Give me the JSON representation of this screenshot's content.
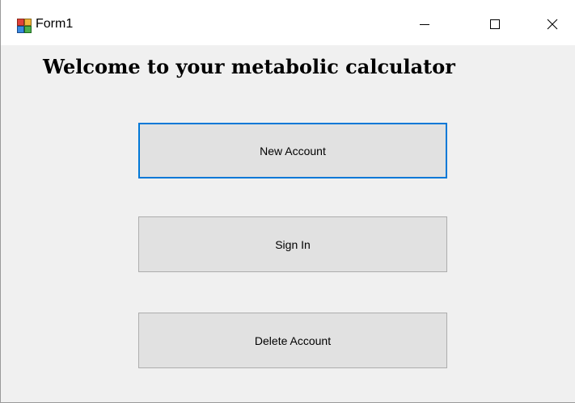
{
  "window": {
    "title": "Form1",
    "icon": "winforms-form-icon",
    "controls": {
      "minimize_icon": "minimize-icon",
      "maximize_icon": "maximize-icon",
      "close_icon": "close-icon"
    }
  },
  "form": {
    "heading": "Welcome to your metabolic calculator",
    "buttons": {
      "new_account": "New Account",
      "sign_in": "Sign In",
      "delete_account": "Delete Account"
    }
  },
  "colors": {
    "form_background": "#f0f0f0",
    "button_face": "#e1e1e1",
    "button_border": "#adadad",
    "focus_border": "#0078d7",
    "titlebar": "#ffffff"
  }
}
